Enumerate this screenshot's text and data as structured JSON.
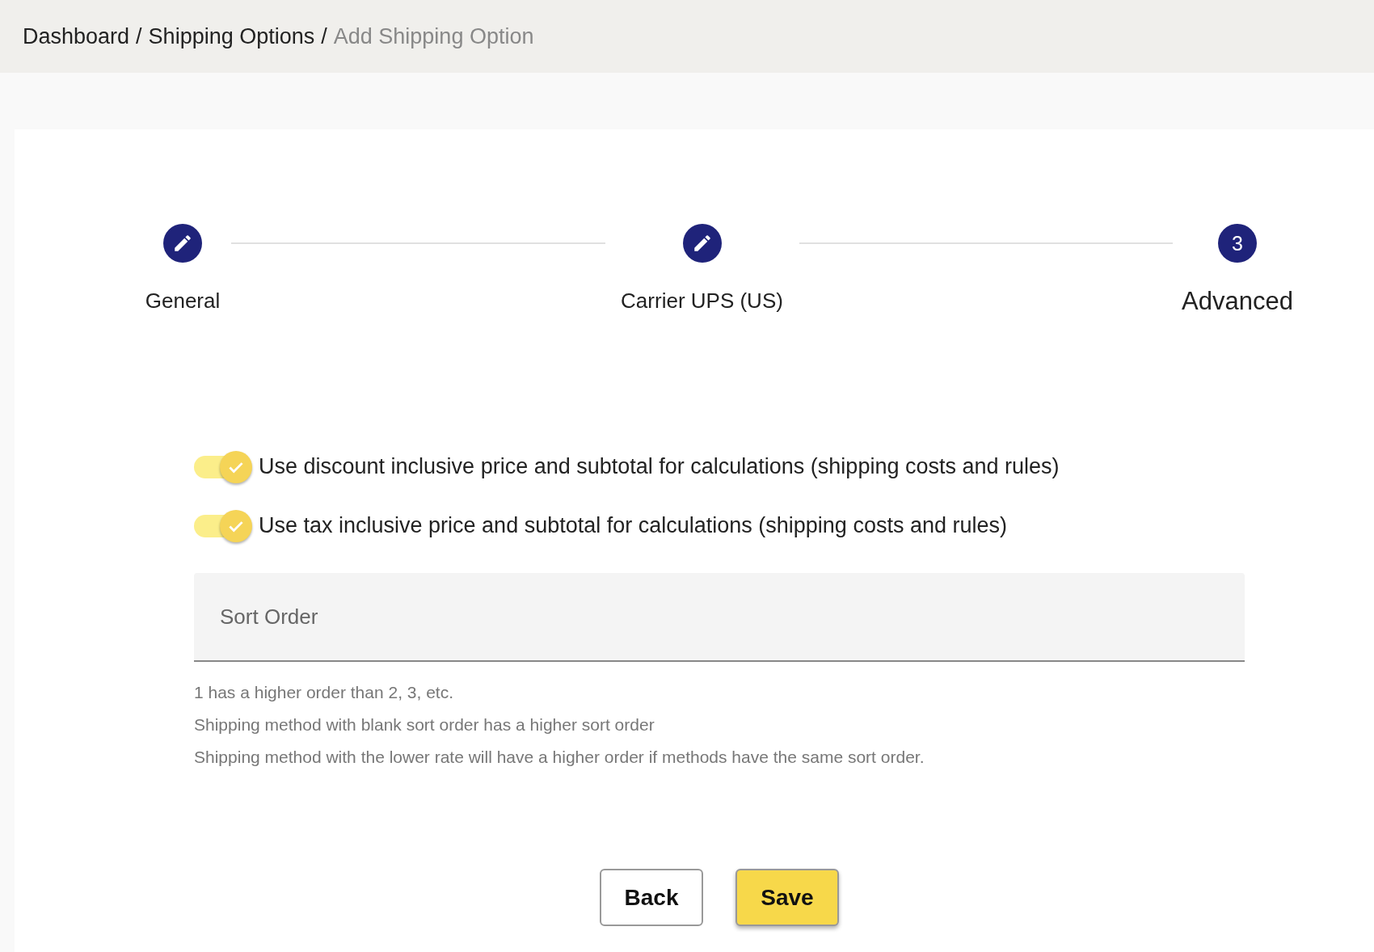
{
  "breadcrumb": [
    {
      "label": "Dashboard",
      "current": false
    },
    {
      "label": "Shipping Options",
      "current": false
    },
    {
      "label": "Add Shipping Option",
      "current": true
    }
  ],
  "breadcrumb_separator": "/",
  "steps": [
    {
      "label": "General",
      "completed": true,
      "selected": false
    },
    {
      "label": "Carrier UPS (US)",
      "completed": true,
      "selected": false
    },
    {
      "label": "Advanced",
      "completed": false,
      "selected": true,
      "number": "3"
    }
  ],
  "toggles": [
    {
      "label": "Use discount inclusive price and subtotal for calculations (shipping costs and rules)",
      "on": true
    },
    {
      "label": "Use tax inclusive price and subtotal for calculations (shipping costs and rules)",
      "on": true
    }
  ],
  "sort_order": {
    "placeholder": "Sort Order"
  },
  "help_lines": [
    "1 has a higher order than 2, 3, etc.",
    "Shipping method with blank sort order has a higher sort order",
    "Shipping method with the lower rate will have a higher order if methods have the same sort order."
  ],
  "buttons": [
    {
      "label": "Back",
      "kind": "secondary"
    },
    {
      "label": "Save",
      "kind": "primary"
    }
  ]
}
